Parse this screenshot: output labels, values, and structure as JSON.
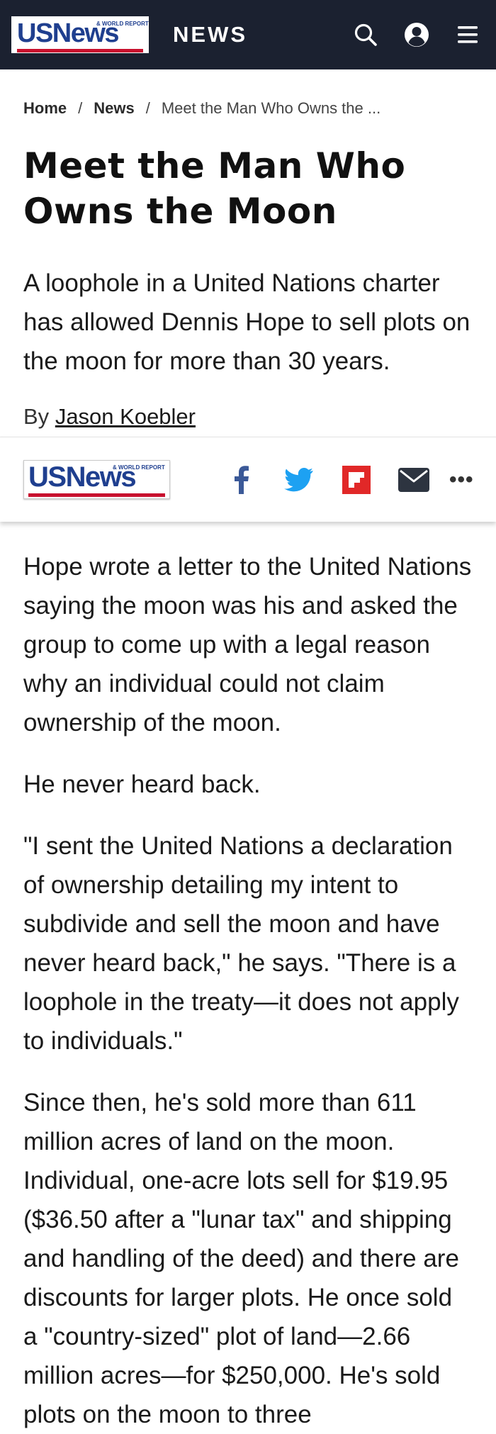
{
  "header": {
    "logo_mark": "USNews",
    "logo_sub": "& WORLD REPORT",
    "section_title": "NEWS",
    "icons": [
      "search-icon",
      "account-icon",
      "menu-icon"
    ],
    "background": "#1b2130"
  },
  "breadcrumb": {
    "items": [
      "Home",
      "News"
    ],
    "current": "Meet the Man Who Owns the ...",
    "separator": "/"
  },
  "article": {
    "headline": "Meet the Man Who Owns the Moon",
    "dek": "A loophole in a United Nations charter has allowed Dennis Hope to sell plots on the moon for more than 30 years.",
    "byline_prefix": "By",
    "author": "Jason Koebler",
    "paragraphs": [
      "Hope wrote a letter to the United Nations saying the moon was his and asked the group to come up with a legal reason why an individual could not claim ownership of the moon.",
      "He never heard back.",
      "\"I sent the United Nations a declaration of ownership detailing my intent to subdivide and sell the moon and have never heard back,\" he says. \"There is a loophole in the treaty—it does not apply to individuals.\"",
      "Since then, he's sold more than 611 million acres of land on the moon. Individual, one-acre lots sell for $19.95 ($36.50 after a \"lunar tax\" and shipping and handling of the deed) and there are discounts for larger plots. He once sold a \"country-sized\" plot of land—2.66 million acres—for $250,000. He's sold plots on the moon to three"
    ]
  },
  "share": {
    "logo_mark": "USNews",
    "logo_sub": "& WORLD REPORT",
    "icons": [
      "facebook-icon",
      "twitter-icon",
      "flipboard-icon",
      "email-icon"
    ],
    "more_label": "•••",
    "colors": {
      "facebook": "#3b5998",
      "twitter": "#1da1f2",
      "flipboard": "#e12828",
      "email": "#2d3440"
    }
  },
  "colors": {
    "logo_blue": "#1f3f8f",
    "logo_red": "#c8102e"
  }
}
